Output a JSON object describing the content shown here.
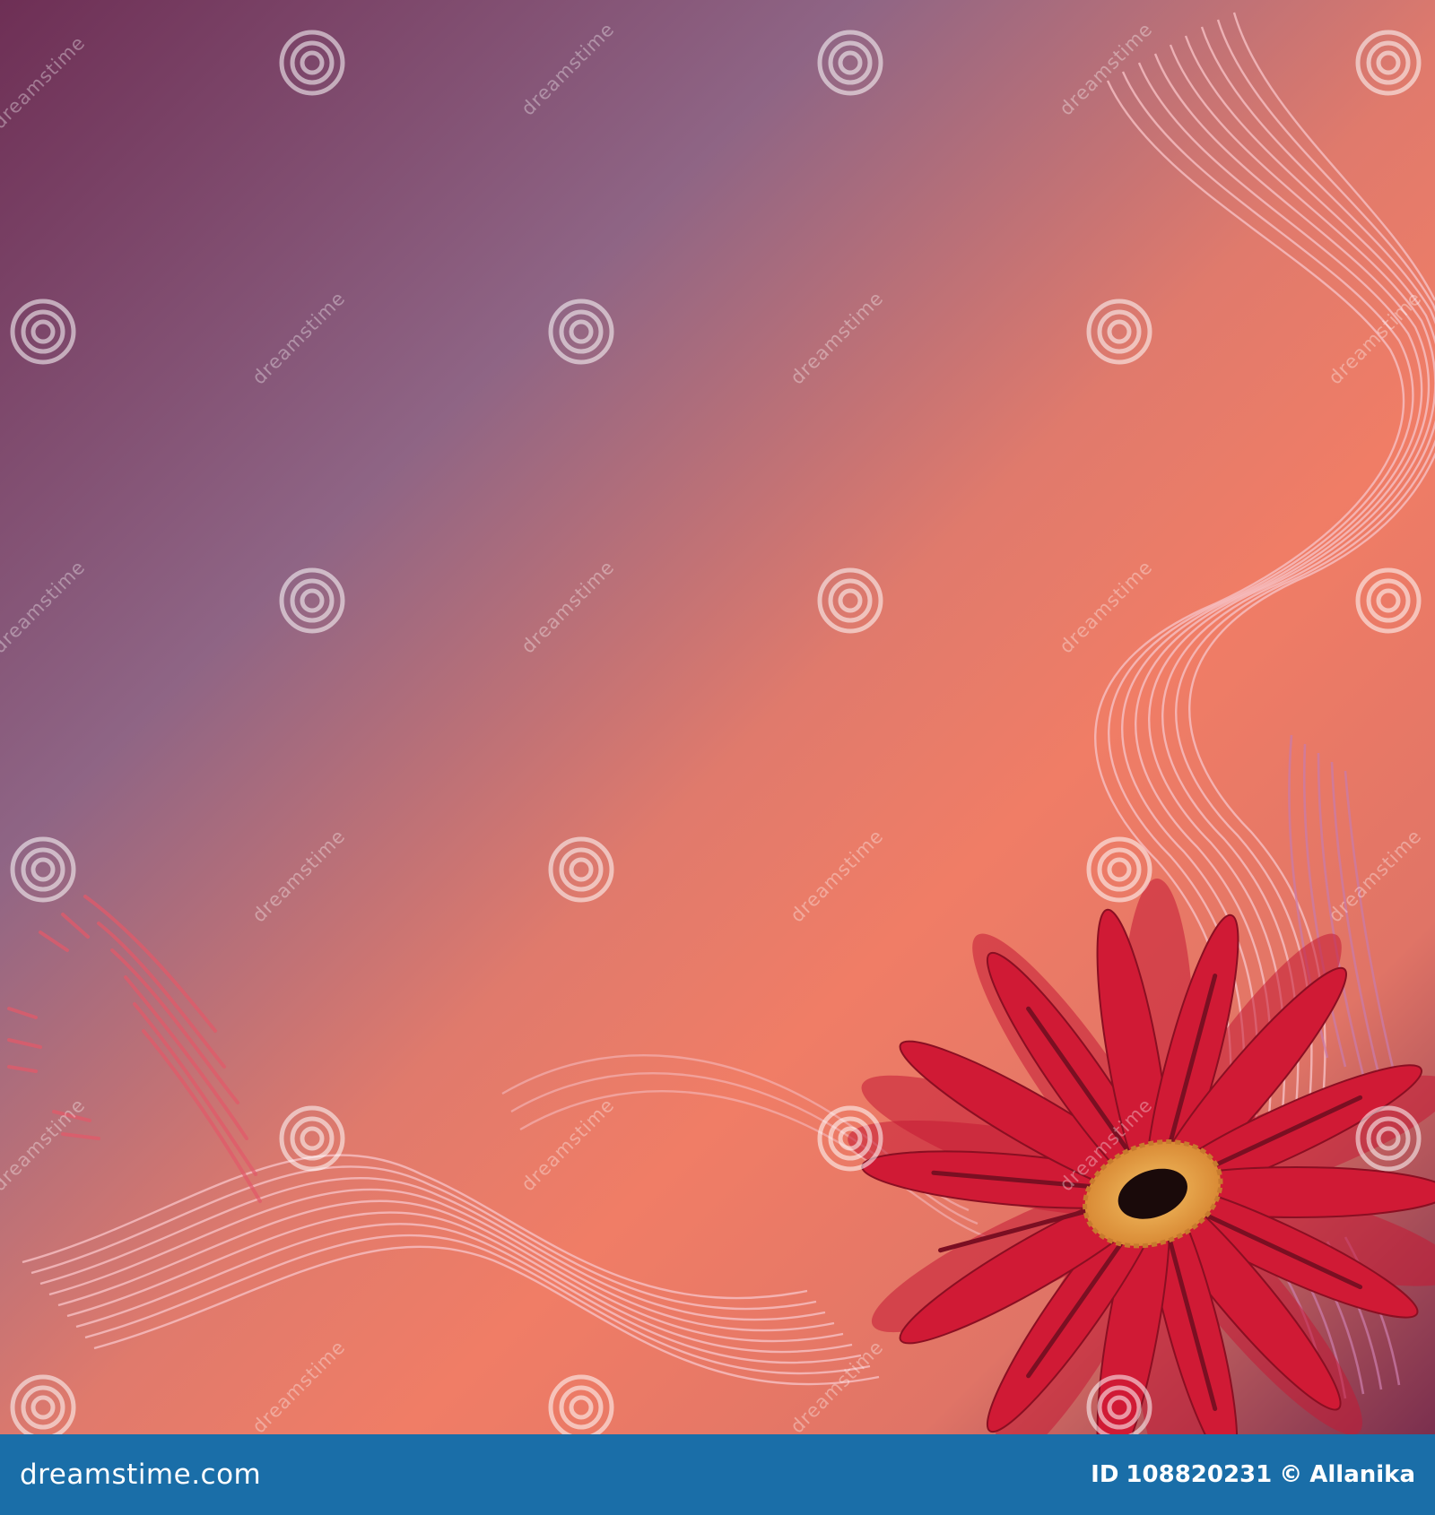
{
  "colors": {
    "background_purple": "#6e2f55",
    "background_lavender": "#8f6585",
    "background_coral": "#ee7d65",
    "flower_red": "#d01a35",
    "flower_dark": "#7a0f22",
    "flower_center": "#e8a447",
    "flower_core": "#1a0a0a",
    "footer_bar": "#1a6ea8"
  },
  "watermark": {
    "text": "dreamstime",
    "icon": "spiral-icon"
  },
  "footer": {
    "site_logo_text": "dreamstime.com",
    "id_label": "ID",
    "id_value": "108820231",
    "copyright_symbol": "©",
    "author": "Allanika"
  }
}
